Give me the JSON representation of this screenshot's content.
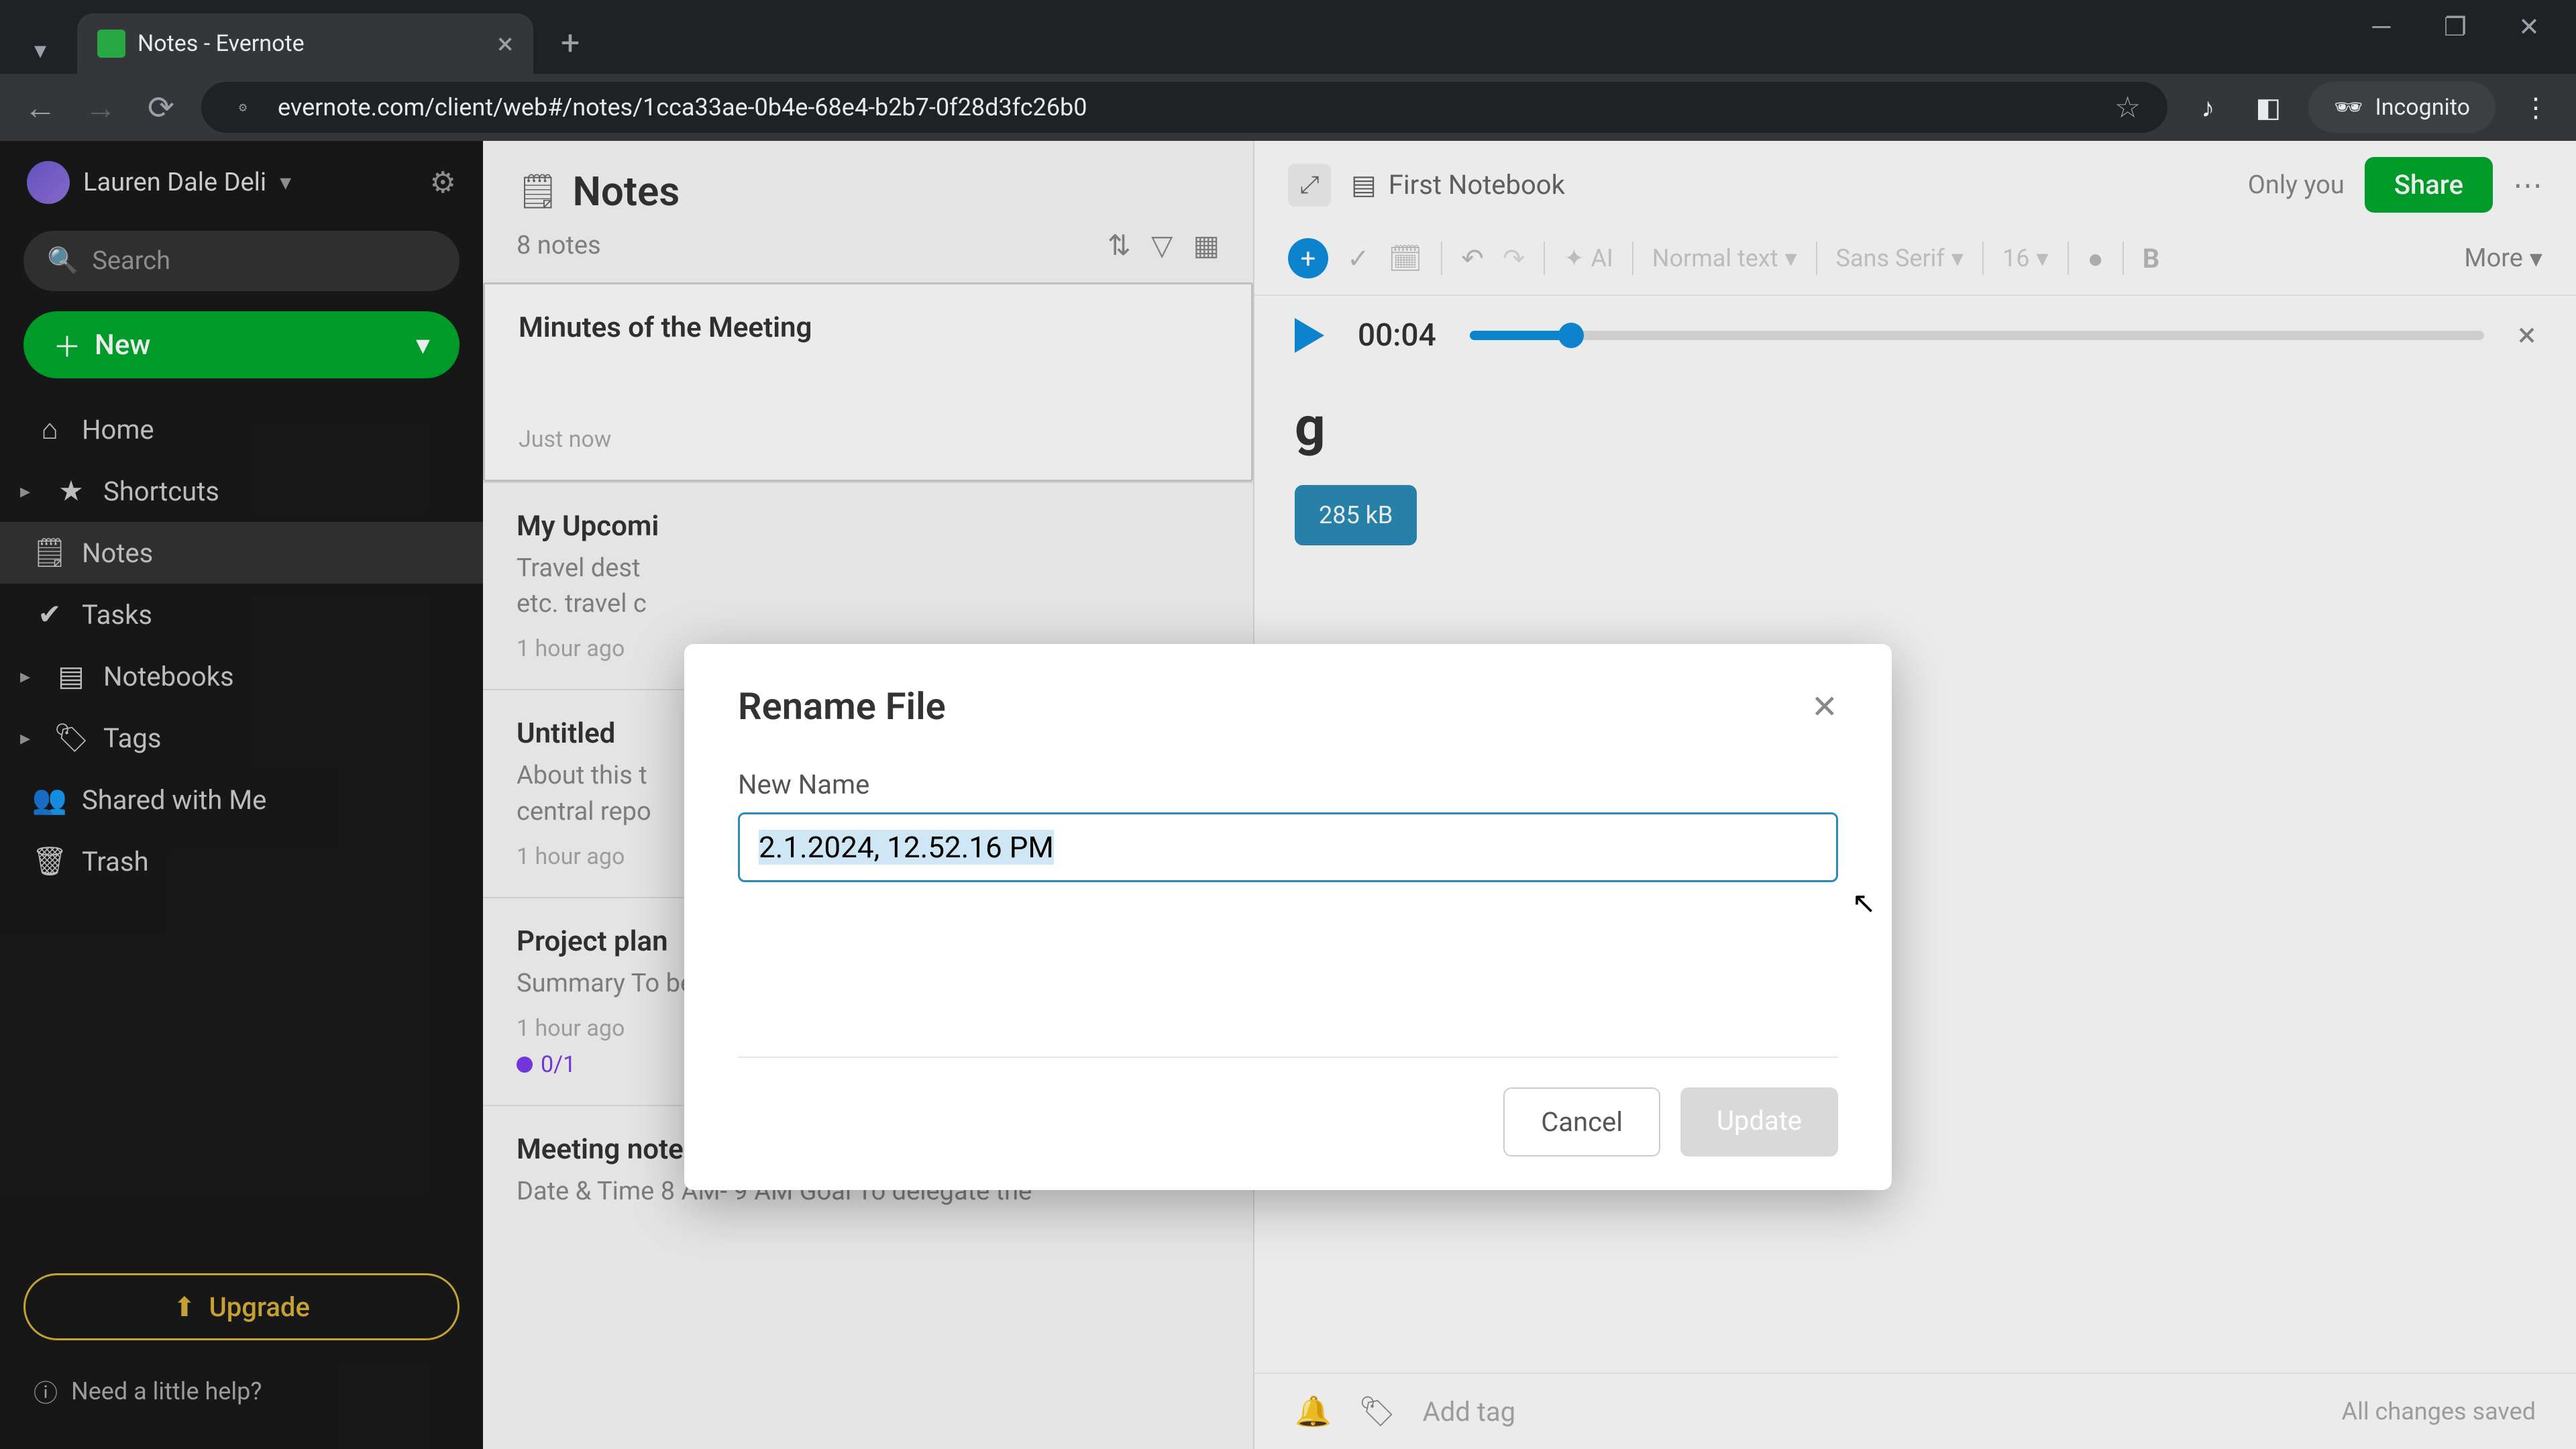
{
  "browser": {
    "tab_title": "Notes - Evernote",
    "url": "evernote.com/client/web#/notes/1cca33ae-0b4e-68e4-b2b7-0f28d3fc26b0",
    "incognito_label": "Incognito"
  },
  "sidebar": {
    "user_name": "Lauren Dale Deli",
    "search_placeholder": "Search",
    "new_button": "New",
    "items": [
      {
        "label": "Home",
        "icon": "home"
      },
      {
        "label": "Shortcuts",
        "icon": "star",
        "expandable": true
      },
      {
        "label": "Notes",
        "icon": "note",
        "active": true
      },
      {
        "label": "Tasks",
        "icon": "check"
      },
      {
        "label": "Notebooks",
        "icon": "book",
        "expandable": true
      },
      {
        "label": "Tags",
        "icon": "tag",
        "expandable": true
      },
      {
        "label": "Shared with Me",
        "icon": "shared"
      },
      {
        "label": "Trash",
        "icon": "trash"
      }
    ],
    "upgrade_button": "Upgrade",
    "help_link": "Need a little help?"
  },
  "notes": {
    "heading": "Notes",
    "count_label": "8 notes",
    "list": [
      {
        "title": "Minutes of the Meeting",
        "preview": "",
        "time": "Just now",
        "selected": true
      },
      {
        "title": "My Upcomi",
        "preview": "Travel dest\netc. travel c",
        "time": "1 hour ago"
      },
      {
        "title": "Untitled",
        "preview": "About this t\ncentral repo",
        "time": "1 hour ago"
      },
      {
        "title": "Project plan",
        "preview": "Summary To be able to etc. Major Milestones …",
        "time": "1 hour ago",
        "tasks": "0/1"
      },
      {
        "title": "Meeting note",
        "preview": "Date & Time 8 AM- 9 AM Goal To delegate the",
        "time": ""
      }
    ]
  },
  "editor": {
    "notebook": "First Notebook",
    "only_you": "Only you",
    "share_button": "Share",
    "ai_label": "AI",
    "style_text": "Normal text",
    "font_family": "Sans Serif",
    "font_size": "16",
    "more_label": "More",
    "audio_time": "00:04",
    "document_title_suffix": "g",
    "file_size": "285 kB",
    "add_tag_label": "Add tag",
    "saved_label": "All changes saved"
  },
  "modal": {
    "title": "Rename File",
    "field_label": "New Name",
    "input_value": "2.1.2024, 12.52.16 PM",
    "cancel_label": "Cancel",
    "update_label": "Update"
  }
}
